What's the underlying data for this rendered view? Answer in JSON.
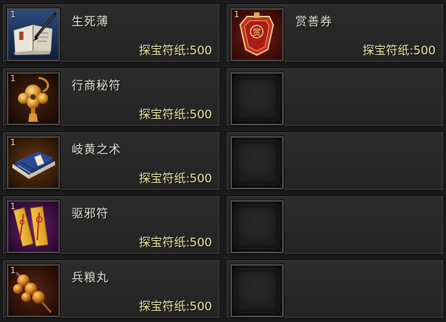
{
  "items": [
    {
      "name": "生死薄",
      "quantity": "1",
      "currency": "探宝符纸",
      "separator": ":",
      "price": "500",
      "icon": "book-brush-icon"
    },
    {
      "name": "赏善券",
      "quantity": "1",
      "currency": "探宝符纸",
      "separator": ":",
      "price": "500",
      "icon": "red-ticket-icon"
    },
    {
      "name": "行商秘符",
      "quantity": "1",
      "currency": "探宝符纸",
      "separator": ":",
      "price": "500",
      "icon": "golden-charm-icon"
    },
    {
      "name": "岐黄之术",
      "quantity": "1",
      "currency": "探宝符纸",
      "separator": ":",
      "price": "500",
      "icon": "blue-scroll-book-icon"
    },
    {
      "name": "驱邪符",
      "quantity": "1",
      "currency": "探宝符纸",
      "separator": ":",
      "price": "500",
      "icon": "talisman-paper-icon"
    },
    {
      "name": "兵粮丸",
      "quantity": "1",
      "currency": "探宝符纸",
      "separator": ":",
      "price": "500",
      "icon": "skewer-balls-icon"
    }
  ],
  "empty_slots": 4,
  "colors": {
    "name_text": "#e8e4da",
    "price_text": "#f0e7a8",
    "panel_bg": "#2b2b2b"
  }
}
